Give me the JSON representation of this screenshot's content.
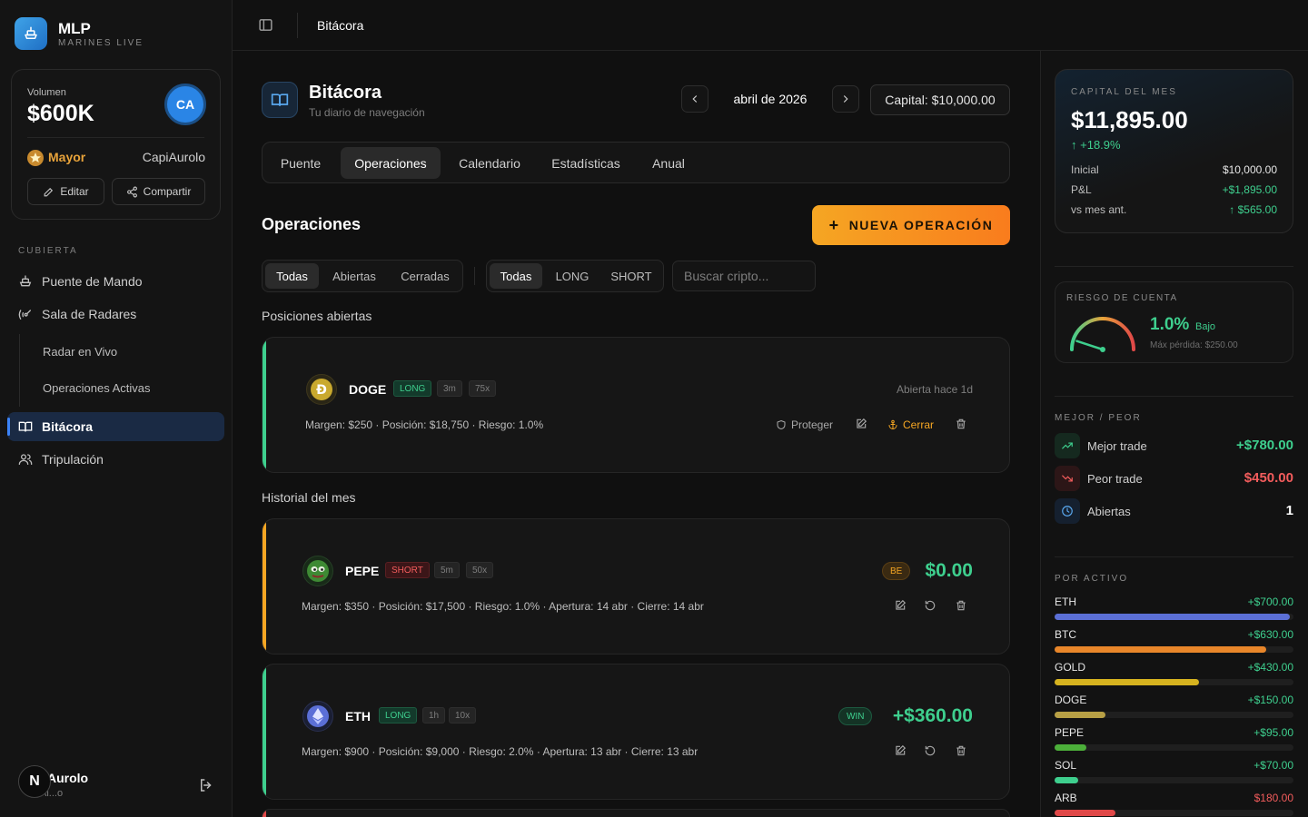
{
  "brand": {
    "title": "MLP",
    "subtitle": "MARINES LIVE"
  },
  "volume_card": {
    "label": "Volumen",
    "value": "$600K",
    "avatar_initials": "CA",
    "rank": "Mayor",
    "username": "CapiAurolo",
    "edit_label": "Editar",
    "share_label": "Compartir"
  },
  "sidebar": {
    "section_caption": "CUBIERTA",
    "items": [
      {
        "label": "Puente de Mando",
        "icon": "ship-icon"
      },
      {
        "label": "Sala de Radares",
        "icon": "radar-icon"
      },
      {
        "label": "Radar en Vivo"
      },
      {
        "label": "Operaciones Activas"
      },
      {
        "label": "Bitácora",
        "icon": "book-icon",
        "active": true
      },
      {
        "label": "Tripulación",
        "icon": "users-icon"
      }
    ],
    "user": {
      "initial": "N",
      "name": "Aurolo",
      "role": "Al...o"
    }
  },
  "topbar": {
    "breadcrumb": "Bitácora"
  },
  "header": {
    "title": "Bitácora",
    "subtitle": "Tu diario de navegación",
    "month": "abril de 2026",
    "capital_label": "Capital: $10,000.00"
  },
  "tabs": [
    {
      "label": "Puente"
    },
    {
      "label": "Operaciones",
      "active": true
    },
    {
      "label": "Calendario"
    },
    {
      "label": "Estadísticas"
    },
    {
      "label": "Anual"
    }
  ],
  "operations": {
    "title": "Operaciones",
    "new_button": "NUEVA OPERACIÓN",
    "status_filters": [
      "Todas",
      "Abiertas",
      "Cerradas"
    ],
    "side_filters": [
      "Todas",
      "LONG",
      "SHORT"
    ],
    "search_placeholder": "Buscar cripto...",
    "open_title": "Posiciones abiertas",
    "history_title": "Historial del mes"
  },
  "open_positions": [
    {
      "symbol": "DOGE",
      "side": "LONG",
      "timeframe": "3m",
      "leverage": "75x",
      "opened": "Abierta hace 1d",
      "meta": "Margen: $250 · Posición: $18,750 · Riesgo: 1.0%",
      "protect_label": "Proteger",
      "close_label": "Cerrar"
    }
  ],
  "history": [
    {
      "symbol": "PEPE",
      "side": "SHORT",
      "timeframe": "5m",
      "leverage": "50x",
      "badge": "BE",
      "pnl": "$0.00",
      "meta": "Margen: $350 · Posición: $17,500 · Riesgo: 1.0% · Apertura: 14 abr · Cierre: 14 abr"
    },
    {
      "symbol": "ETH",
      "side": "LONG",
      "timeframe": "1h",
      "leverage": "10x",
      "badge": "WIN",
      "pnl": "+$360.00",
      "meta": "Margen: $900 · Posición: $9,000 · Riesgo: 2.0% · Apertura: 13 abr · Cierre: 13 abr"
    }
  ],
  "capital_card": {
    "caption": "CAPITAL DEL MES",
    "value": "$11,895.00",
    "change": "+18.9%",
    "rows": [
      {
        "label": "Inicial",
        "value": "$10,000.00"
      },
      {
        "label": "P&L",
        "value": "+$1,895.00"
      },
      {
        "label": "vs mes ant.",
        "value": "$565.00"
      }
    ]
  },
  "risk_card": {
    "caption": "RIESGO DE CUENTA",
    "value": "1.0%",
    "level": "Bajo",
    "max_loss": "Máx pérdida: $250.00",
    "gauge_fraction": 0.1
  },
  "best_worst": {
    "caption": "MEJOR / PEOR",
    "rows": [
      {
        "label": "Mejor trade",
        "value": "+$780.00"
      },
      {
        "label": "Peor trade",
        "value": "$450.00"
      },
      {
        "label": "Abiertas",
        "value": "1"
      }
    ]
  },
  "by_asset": {
    "caption": "POR ACTIVO",
    "assets": [
      {
        "name": "ETH",
        "value": "+$700.00",
        "amount": 700,
        "color": "#5b6fd6"
      },
      {
        "name": "BTC",
        "value": "+$630.00",
        "amount": 630,
        "color": "#e8862a"
      },
      {
        "name": "GOLD",
        "value": "+$430.00",
        "amount": 430,
        "color": "#d6b31f"
      },
      {
        "name": "DOGE",
        "value": "+$150.00",
        "amount": 150,
        "color": "#b8a045"
      },
      {
        "name": "PEPE",
        "value": "+$95.00",
        "amount": 95,
        "color": "#4caf3a"
      },
      {
        "name": "SOL",
        "value": "+$70.00",
        "amount": 70,
        "color": "#3ecf8e"
      },
      {
        "name": "ARB",
        "value": "$180.00",
        "amount": 180,
        "color": "#e04848"
      }
    ],
    "max": 710
  },
  "colors": {
    "accent_blue": "#3b82f6",
    "green": "#3ecf8e",
    "red": "#f25c5c",
    "orange": "#f5a623"
  }
}
